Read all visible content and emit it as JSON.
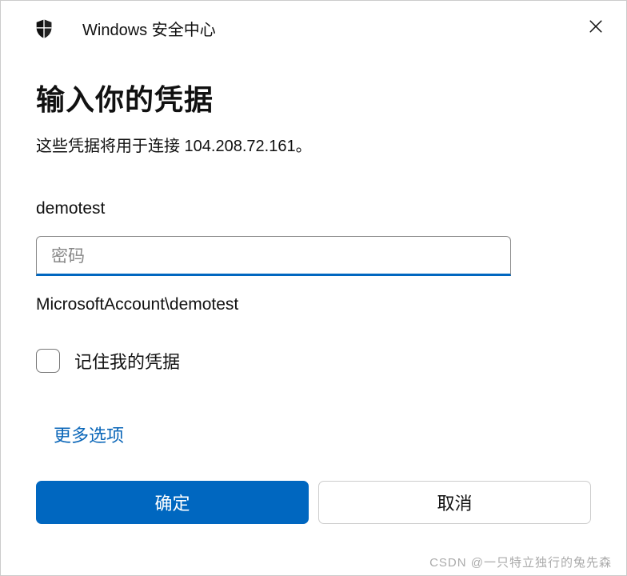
{
  "titlebar": {
    "title": "Windows 安全中心"
  },
  "heading": "输入你的凭据",
  "subtext": "这些凭据将用于连接 104.208.72.161。",
  "username": "demotest",
  "password": {
    "placeholder": "密码",
    "value": ""
  },
  "account_line": "MicrosoftAccount\\demotest",
  "remember_label": "记住我的凭据",
  "more_options": "更多选项",
  "buttons": {
    "ok": "确定",
    "cancel": "取消"
  },
  "watermark": "CSDN @一只特立独行的兔先森"
}
